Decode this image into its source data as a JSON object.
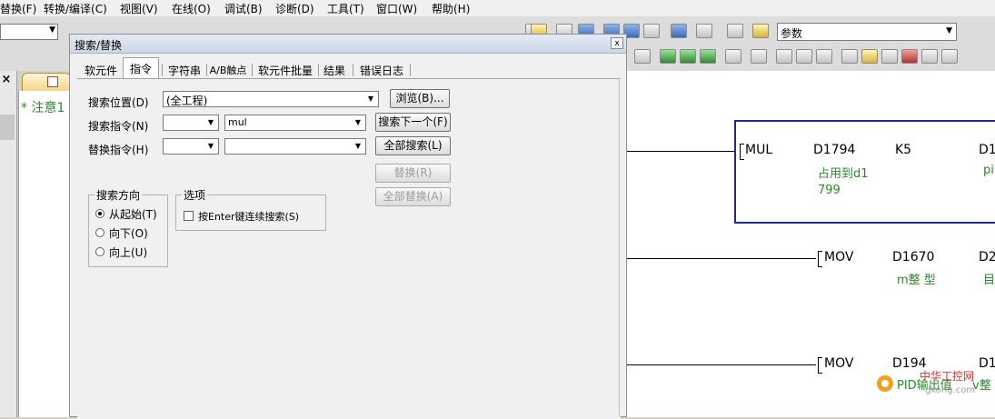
{
  "menubar": {
    "items": [
      "替换(F)",
      "转换/编译(C)",
      "视图(V)",
      "在线(O)",
      "调试(B)",
      "诊断(D)",
      "工具(T)",
      "窗口(W)",
      "帮助(H)"
    ]
  },
  "toolbar": {
    "param_combo": "参数"
  },
  "editor": {
    "note": "* 注意1"
  },
  "ladder": {
    "rungs": [
      {
        "instruction": "MUL",
        "op1": "D1794",
        "op2": "K5",
        "op3": "D1",
        "comment1": "占用到d1",
        "comment1b": "799",
        "comment3": "pi"
      },
      {
        "instruction": "MOV",
        "op1": "D1670",
        "op3": "D2",
        "comment1": "m整 型",
        "comment3": "目"
      },
      {
        "instruction": "MOV",
        "op1": "D194",
        "op3": "D1",
        "comment1": "PID输出值",
        "comment3": "v整"
      }
    ]
  },
  "dialog": {
    "title": "搜索/替换",
    "close": "x",
    "tabs": [
      "软元件",
      "指令",
      "字符串",
      "A/B触点",
      "软元件批量",
      "结果",
      "错误日志"
    ],
    "search_location_label": "搜索位置(D)",
    "search_location_value": "(全工程)",
    "browse_button": "浏览(B)...",
    "search_instruction_label": "搜索指令(N)",
    "search_instruction_value": "mul",
    "replace_instruction_label": "替换指令(H)",
    "find_next_button": "搜索下一个(F)",
    "find_all_button": "全部搜索(L)",
    "replace_button": "替换(R)",
    "replace_all_button": "全部替换(A)",
    "direction_group": "搜索方向",
    "direction_options": [
      "从起始(T)",
      "向下(O)",
      "向上(U)"
    ],
    "options_group": "选项",
    "enter_continue_label": "按Enter键连续搜索(S)"
  },
  "watermark": {
    "line1": "中华工控网",
    "line2": "gkong.com"
  }
}
